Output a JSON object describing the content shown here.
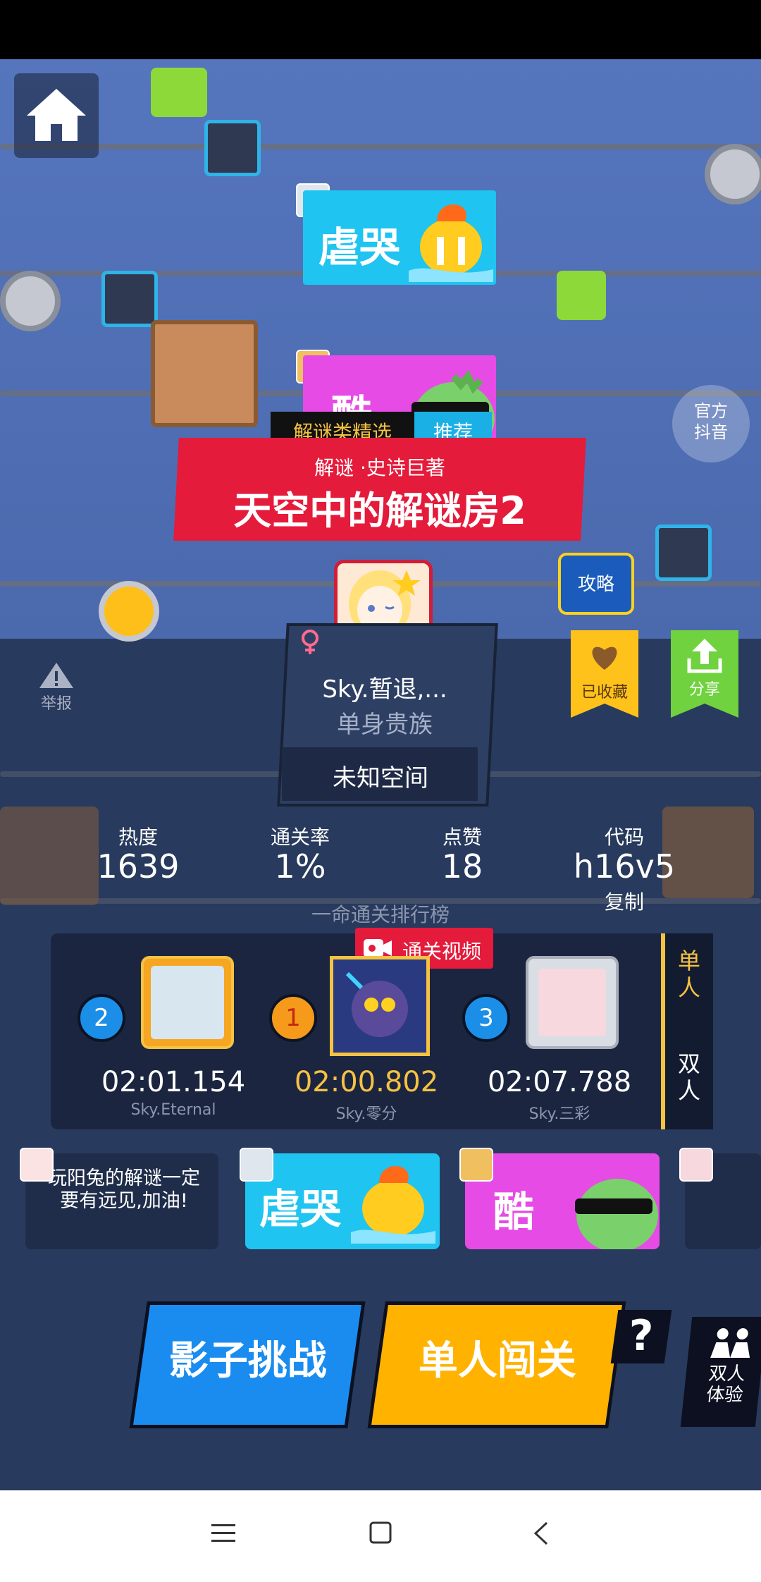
{
  "featured_tags": [
    {
      "text": "虐哭",
      "color": "#1fc4f0"
    },
    {
      "text": "酷",
      "color": "#e74be6"
    }
  ],
  "banner": {
    "tab_left": "解谜类精选",
    "tab_right": "推荐",
    "subtitle": "解谜 ·史诗巨著",
    "title": "天空中的解谜房2",
    "guide_label": "攻略"
  },
  "side_labels": {
    "official": "官方\n抖音",
    "report": "举报",
    "favorite": "已收藏",
    "share": "分享"
  },
  "player": {
    "name": "Sky.暂退,...",
    "rank_title": "单身贵族",
    "space": "未知空间"
  },
  "stats": {
    "heat_label": "热度",
    "heat_value": "1639",
    "clear_label": "通关率",
    "clear_value": "1%",
    "like_label": "点赞",
    "like_value": "18",
    "code_label": "代码",
    "code_value": "h16v5",
    "copy_label": "复制"
  },
  "leaderboard": {
    "title": "一命通关排行榜",
    "video_badge": "通关视频",
    "side_tab_single": "单\n人",
    "side_tab_double": "双\n人",
    "entries": [
      {
        "rank": "2",
        "time": "02:01.154",
        "user": "Sky.Eternal"
      },
      {
        "rank": "1",
        "time": "02:00.802",
        "user": "Sky.零分"
      },
      {
        "rank": "3",
        "time": "02:07.788",
        "user": "Sky.三彩"
      }
    ]
  },
  "comments": [
    {
      "text": "玩阳兔的解谜一定要有远见,加油!"
    }
  ],
  "buttons": {
    "shadow": "影子挑战",
    "single": "单人闯关",
    "help": "?",
    "duo": "双人\n体验"
  },
  "colors": {
    "accent_blue": "#1a8cf0",
    "accent_yellow": "#ffb200",
    "banner_red": "#e41b3b",
    "gold_text": "#f5c242"
  }
}
